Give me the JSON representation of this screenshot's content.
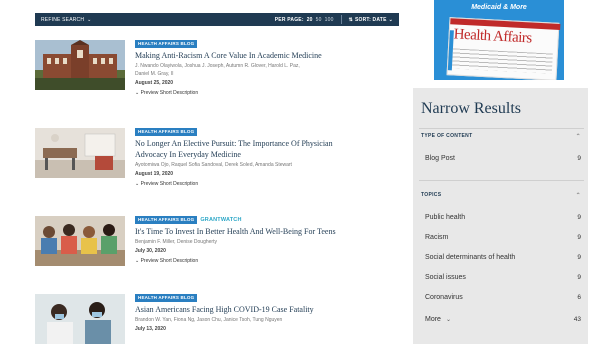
{
  "toolbar": {
    "refine_label": "REFINE SEARCH",
    "per_page_label": "PER PAGE:",
    "per_page_options": [
      "20",
      "50",
      "100"
    ],
    "sort_label": "SORT: DATE"
  },
  "results": [
    {
      "tags": [
        "HEALTH AFFAIRS BLOG"
      ],
      "title": "Making Anti-Racism A Core Value In Academic Medicine",
      "authors": "J. Nwando Olayiwola, Joshua J. Joseph, Autumn R. Glover, Harold L. Paz,",
      "authors2": "Daniel M. Gray, II",
      "date": "August 25, 2020",
      "preview": "Preview Short Description"
    },
    {
      "tags": [
        "HEALTH AFFAIRS BLOG"
      ],
      "title": "No Longer An Elective Pursuit: The Importance Of Physician",
      "title2": "Advocacy In Everyday Medicine",
      "authors": "Ayotomiwa Ojo, Raquel Sofia Sandoval, Derek Soled, Amanda Stewart",
      "date": "August 19, 2020",
      "preview": "Preview Short Description"
    },
    {
      "tags": [
        "HEALTH AFFAIRS BLOG"
      ],
      "tag2": "GRANTWATCH",
      "title": "It's Time To Invest In Better Health And Well-Being For Teens",
      "authors": "Benjamin F. Miller, Denise Dougherty",
      "date": "July 30, 2020",
      "preview": "Preview Short Description"
    },
    {
      "tags": [
        "HEALTH AFFAIRS BLOG"
      ],
      "title": "Asian Americans Facing High COVID-19 Case Fatality",
      "authors": "Brandon W. Yan, Fiona Ng, Jason Chu, Janice Tsoh, Tung Nguyen",
      "date": "July 13, 2020"
    }
  ],
  "ad": {
    "headline": "Medicaid & More",
    "magazine": "Health Affairs"
  },
  "sidebar": {
    "title": "Narrow Results",
    "type_header": "TYPE OF CONTENT",
    "type_items": [
      {
        "label": "Blog Post",
        "count": "9"
      }
    ],
    "topics_header": "TOPICS",
    "topics_items": [
      {
        "label": "Public health",
        "count": "9"
      },
      {
        "label": "Racism",
        "count": "9"
      },
      {
        "label": "Social determinants of health",
        "count": "9"
      },
      {
        "label": "Social issues",
        "count": "9"
      },
      {
        "label": "Coronavirus",
        "count": "6"
      }
    ],
    "more_label": "More",
    "more_count": "43"
  },
  "colors": {
    "navy": "#1f3a52",
    "tag_blue": "#2a7fc1",
    "grantwatch": "#2aa6c6",
    "sidebar_bg": "#e8e8e8"
  }
}
